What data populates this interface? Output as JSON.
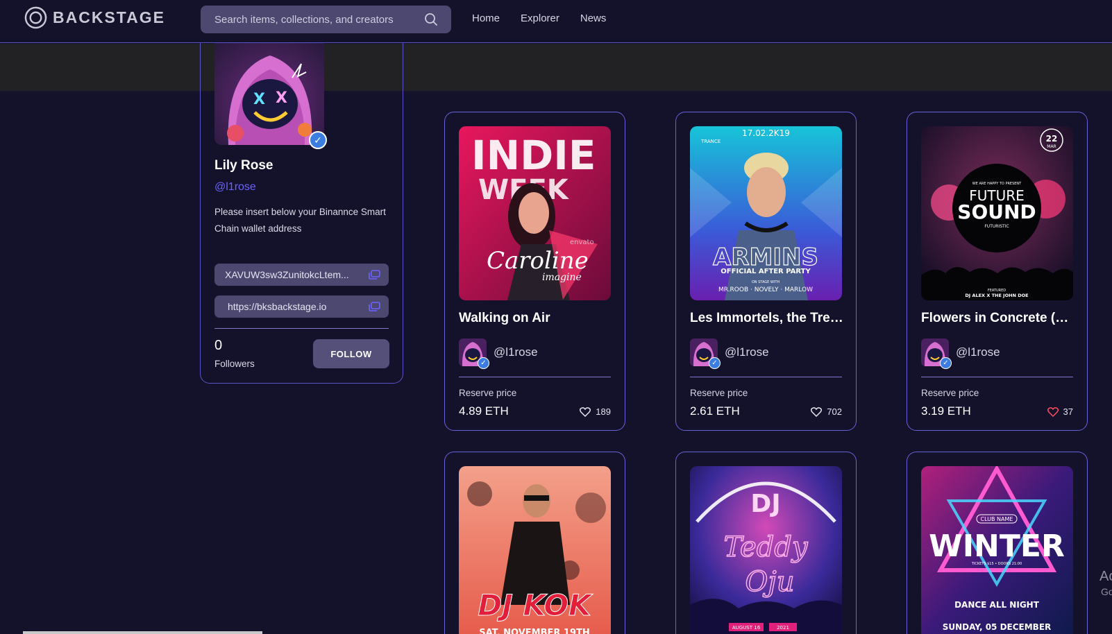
{
  "app": {
    "logo_text": "BACKSTAGE"
  },
  "search": {
    "placeholder": "Search items, collections, and creators"
  },
  "nav": {
    "items": [
      "Home",
      "Explorer",
      "News"
    ]
  },
  "profile": {
    "name": "Lily Rose",
    "handle": "@l1rose",
    "description": "Please insert below your Binannce Smart Chain wallet address",
    "wallet_address": "XAVUW3sw3ZunitokcLtem...",
    "website": "https://bksbackstage.io",
    "followers_count": "0",
    "followers_label": "Followers",
    "follow_label": "FOLLOW"
  },
  "cards": [
    {
      "title": "Walking on Air",
      "creator": "@l1rose",
      "reserve_label": "Reserve price",
      "price": "4.89 ETH",
      "likes": "189",
      "liked": false
    },
    {
      "title": "Les Immortels, the Treasure of the Pacific",
      "creator": "@l1rose",
      "reserve_label": "Reserve price",
      "price": "2.61 ETH",
      "likes": "702",
      "liked": false
    },
    {
      "title": "Flowers in Concrete (Mixtape)",
      "creator": "@l1rose",
      "reserve_label": "Reserve price",
      "price": "3.19 ETH",
      "likes": "37",
      "liked": true
    }
  ],
  "artwork_text": {
    "indie": {
      "line1": "INDIE",
      "line2": "WEEK",
      "script": "Caroline",
      "sub": "imagine",
      "wm": "envato"
    },
    "armins": {
      "date": "17.02.2K19",
      "name": "ARMINS",
      "tag": "OFFICIAL AFTER PARTY",
      "with": "ON STAGE WITH",
      "lineup": "MR.ROOB · NOVELY · MARLOW",
      "badge": "TRANCE"
    },
    "future": {
      "day": "22",
      "month": "MAR",
      "pre": "WE ARE HAPPY TO PRESENT",
      "l1": "FUTURE",
      "l2": "SOUND",
      "l3": "FUTURISTIC",
      "feat": "FEATURED",
      "djs": "DJ ALEX X THE JOHN DOE"
    },
    "dj": {
      "word": "DJ KOK",
      "date": "SAT, NOVEMBER 19TH"
    },
    "teddy": {
      "dj": "DJ",
      "name1": "Teddy",
      "name2": "Oju",
      "date": "AUGUST 16",
      "year": "2021"
    },
    "winter": {
      "club": "CLUB NAME",
      "word": "WINTER",
      "tickets": "TICKETS $15 • DOORS 21:00",
      "dance": "DANCE ALL NIGHT",
      "date": "SUNDAY, 05 DECEMBER"
    }
  },
  "overlay": {
    "activate": "Ac",
    "goto": "Go"
  },
  "colors": {
    "accent": "#6c63ff",
    "border": "#5a52c9",
    "background": "#13122a",
    "field": "#4d4870",
    "liked": "#ff4d5e"
  }
}
